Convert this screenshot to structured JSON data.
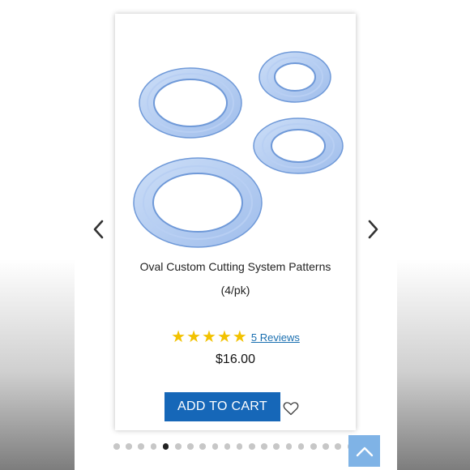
{
  "product": {
    "title_line1": "Oval Custom Cutting System Patterns",
    "title_line2": "(4/pk)",
    "rating": 5,
    "rating_max": 5,
    "reviews_label": "5 Reviews",
    "price": "$16.00",
    "add_to_cart_label": "ADD TO CART"
  },
  "carousel": {
    "dot_count": 20,
    "active_index": 4
  },
  "icons": {
    "prev": "chevron-left-icon",
    "next": "chevron-right-icon",
    "wishlist": "heart-outline-icon",
    "back_to_top": "chevron-up-icon",
    "star": "star-filled-icon"
  },
  "colors": {
    "button": "#1667b8",
    "star": "#f2c200",
    "link": "#1a6fb0",
    "back_to_top": "#7fb3e6",
    "oval_fill": "#a9c6f0",
    "oval_stroke": "#6f99d8"
  }
}
